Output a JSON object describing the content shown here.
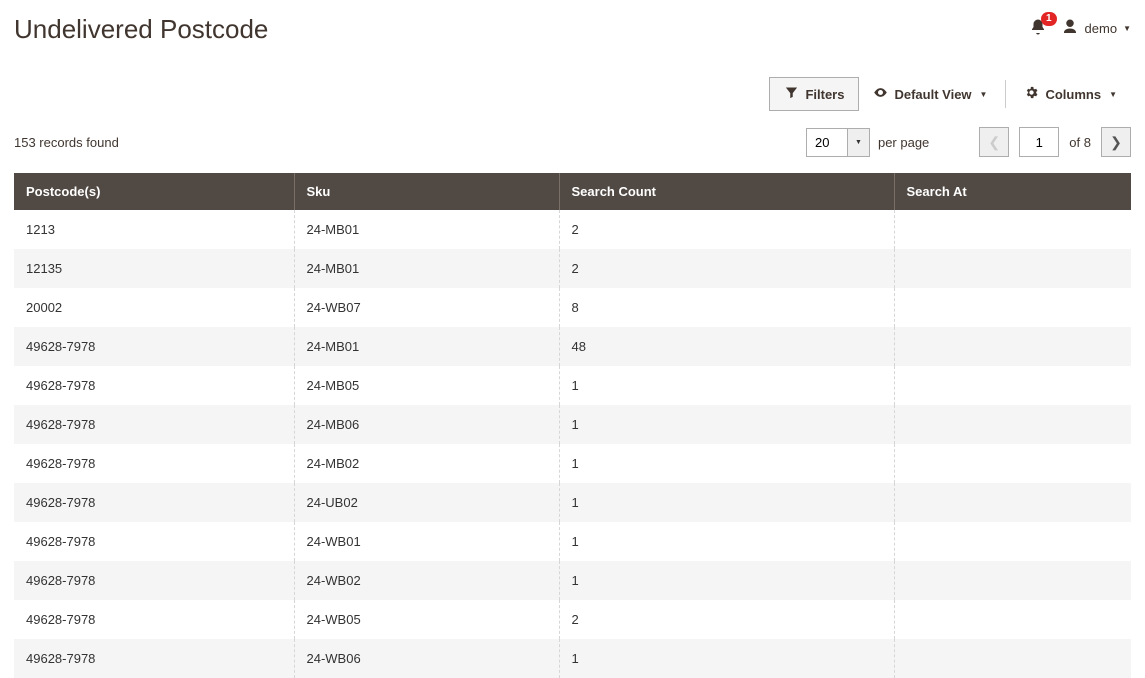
{
  "header": {
    "title": "Undelivered Postcode",
    "notifications_count": "1",
    "user_name": "demo"
  },
  "toolbar": {
    "filters_label": "Filters",
    "default_view_label": "Default View",
    "columns_label": "Columns"
  },
  "meta": {
    "records_found": "153 records found",
    "per_page_value": "20",
    "per_page_label": "per page",
    "current_page": "1",
    "of_label": "of",
    "total_pages": "8"
  },
  "table": {
    "headers": {
      "postcode": "Postcode(s)",
      "sku": "Sku",
      "count": "Search Count",
      "at": "Search At"
    },
    "rows": [
      {
        "postcode": "1213",
        "sku": "24-MB01",
        "count": "2",
        "at": ""
      },
      {
        "postcode": "12135",
        "sku": "24-MB01",
        "count": "2",
        "at": ""
      },
      {
        "postcode": "20002",
        "sku": "24-WB07",
        "count": "8",
        "at": ""
      },
      {
        "postcode": "49628-7978",
        "sku": "24-MB01",
        "count": "48",
        "at": ""
      },
      {
        "postcode": "49628-7978",
        "sku": "24-MB05",
        "count": "1",
        "at": ""
      },
      {
        "postcode": "49628-7978",
        "sku": "24-MB06",
        "count": "1",
        "at": ""
      },
      {
        "postcode": "49628-7978",
        "sku": "24-MB02",
        "count": "1",
        "at": ""
      },
      {
        "postcode": "49628-7978",
        "sku": "24-UB02",
        "count": "1",
        "at": ""
      },
      {
        "postcode": "49628-7978",
        "sku": "24-WB01",
        "count": "1",
        "at": ""
      },
      {
        "postcode": "49628-7978",
        "sku": "24-WB02",
        "count": "1",
        "at": ""
      },
      {
        "postcode": "49628-7978",
        "sku": "24-WB05",
        "count": "2",
        "at": ""
      },
      {
        "postcode": "49628-7978",
        "sku": "24-WB06",
        "count": "1",
        "at": ""
      }
    ]
  }
}
